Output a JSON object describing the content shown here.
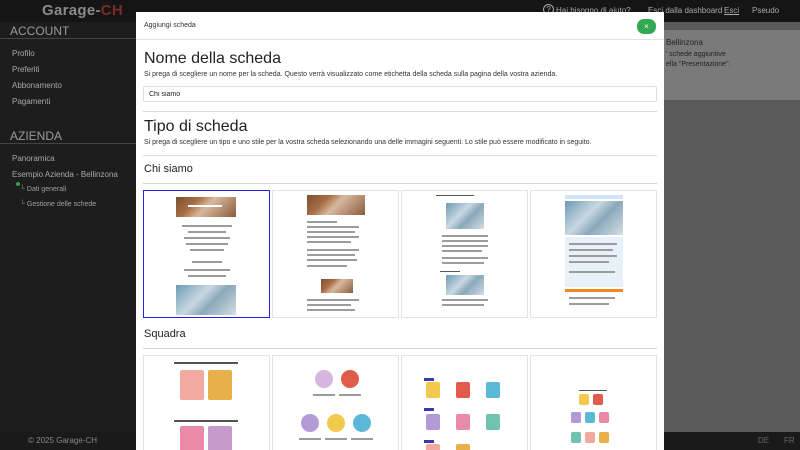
{
  "app": {
    "brand_main": "Garage-",
    "brand_accent": "CH",
    "help_label": "Hai bisogno di aiuto?",
    "exit_label": "Esci dalla dashboard",
    "logout_label": "Esci",
    "user_label": "Pseudo"
  },
  "sidebar": {
    "account_heading": "ACCOUNT",
    "account_items": [
      "Profilo",
      "Preferiti",
      "Abbonamento",
      "Pagamenti"
    ],
    "company_heading": "AZIENDA",
    "company_items": [
      "Panoramica",
      "Esempio Azienda - Bellinzona"
    ],
    "company_subitems": [
      "Dati generali",
      "Gestione delle schede"
    ]
  },
  "background_panel": {
    "line1": "Bellinzona",
    "line2": "' schede aggiuntive",
    "line3": "ella \"Presentazione\"."
  },
  "footer": {
    "copyright": "© 2025 Garage-CH",
    "lang_de": "DE",
    "lang_fr": "FR"
  },
  "modal": {
    "title": "Aggiungi scheda",
    "close_symbol": "×",
    "name_heading": "Nome della scheda",
    "name_hint": "Si prega di scegliere un nome per la scheda. Questo verrà visualizzato come etichetta della scheda sulla pagina della vostra azienda.",
    "name_value": "Chi siamo",
    "type_heading": "Tipo di scheda",
    "type_hint": "Si prega di scegliere un tipo e uno stile per la vostra scheda selezionando una delle immagini seguenti. Lo stile può essere modificato in seguito.",
    "sections": [
      {
        "title": "Chi siamo"
      },
      {
        "title": "Squadra"
      }
    ]
  },
  "colors": {
    "accent_green": "#33a852",
    "selection_blue": "#2222ee",
    "brand_red": "#7a2b2b"
  }
}
